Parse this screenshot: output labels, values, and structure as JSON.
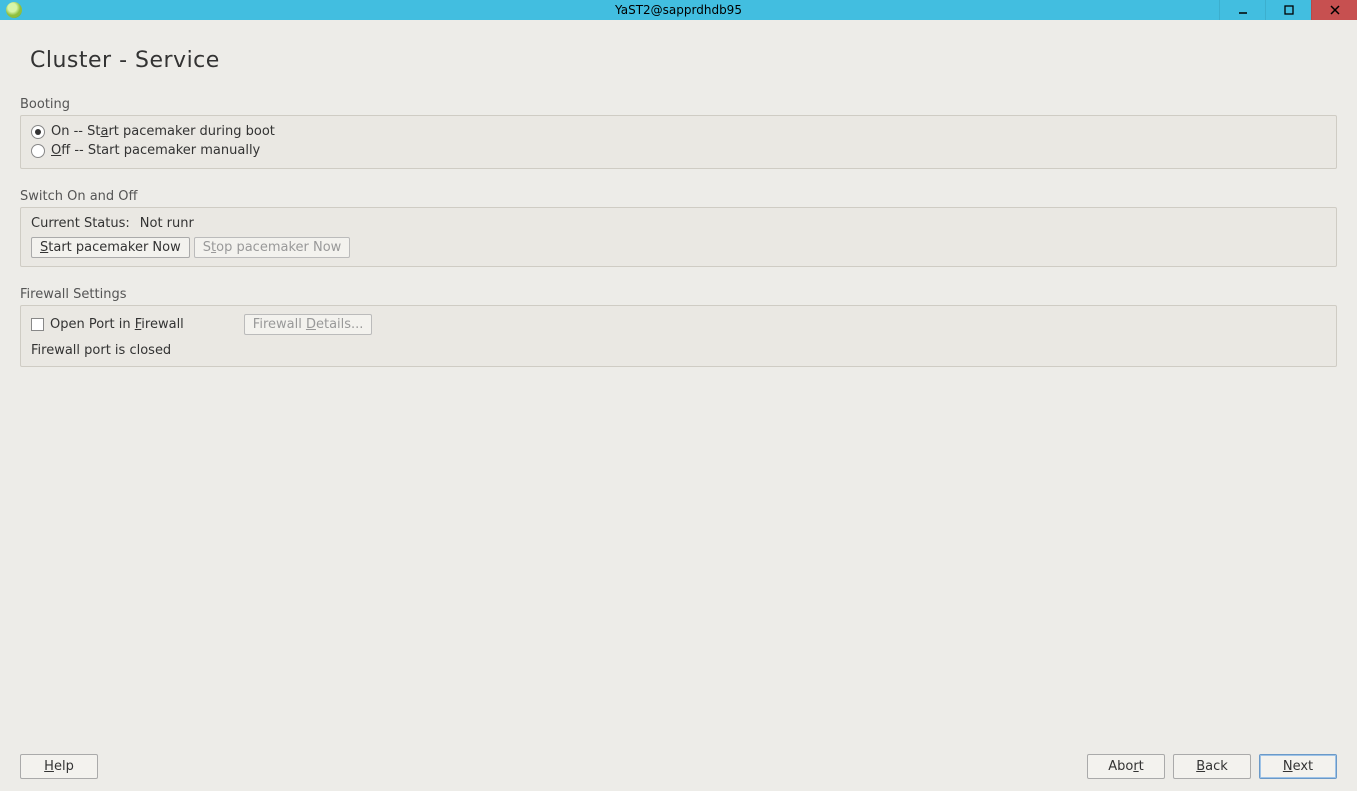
{
  "window": {
    "title": "YaST2@sapprdhdb95"
  },
  "page": {
    "title": "Cluster - Service"
  },
  "booting": {
    "label": "Booting",
    "on_prefix": "On -- St",
    "on_ul": "a",
    "on_suffix": "rt pacemaker during boot",
    "off_ul": "O",
    "off_suffix": "ff -- Start pacemaker manually"
  },
  "switch": {
    "label": "Switch On and Off",
    "status_label": "Current Status: ",
    "status_value": "Not runr",
    "start_ul": "S",
    "start_suffix": "tart pacemaker Now",
    "stop_prefix": "S",
    "stop_ul": "t",
    "stop_suffix": "op pacemaker Now"
  },
  "firewall": {
    "label": "Firewall Settings",
    "open_prefix": "Open Port in ",
    "open_ul": "F",
    "open_suffix": "irewall",
    "details_prefix": "Firewall ",
    "details_ul": "D",
    "details_suffix": "etails...",
    "status": "Firewall port is closed"
  },
  "footer": {
    "help_ul": "H",
    "help_suffix": "elp",
    "abort_prefix": "Abo",
    "abort_ul": "r",
    "abort_suffix": "t",
    "back_ul": "B",
    "back_suffix": "ack",
    "next_ul": "N",
    "next_suffix": "ext"
  }
}
